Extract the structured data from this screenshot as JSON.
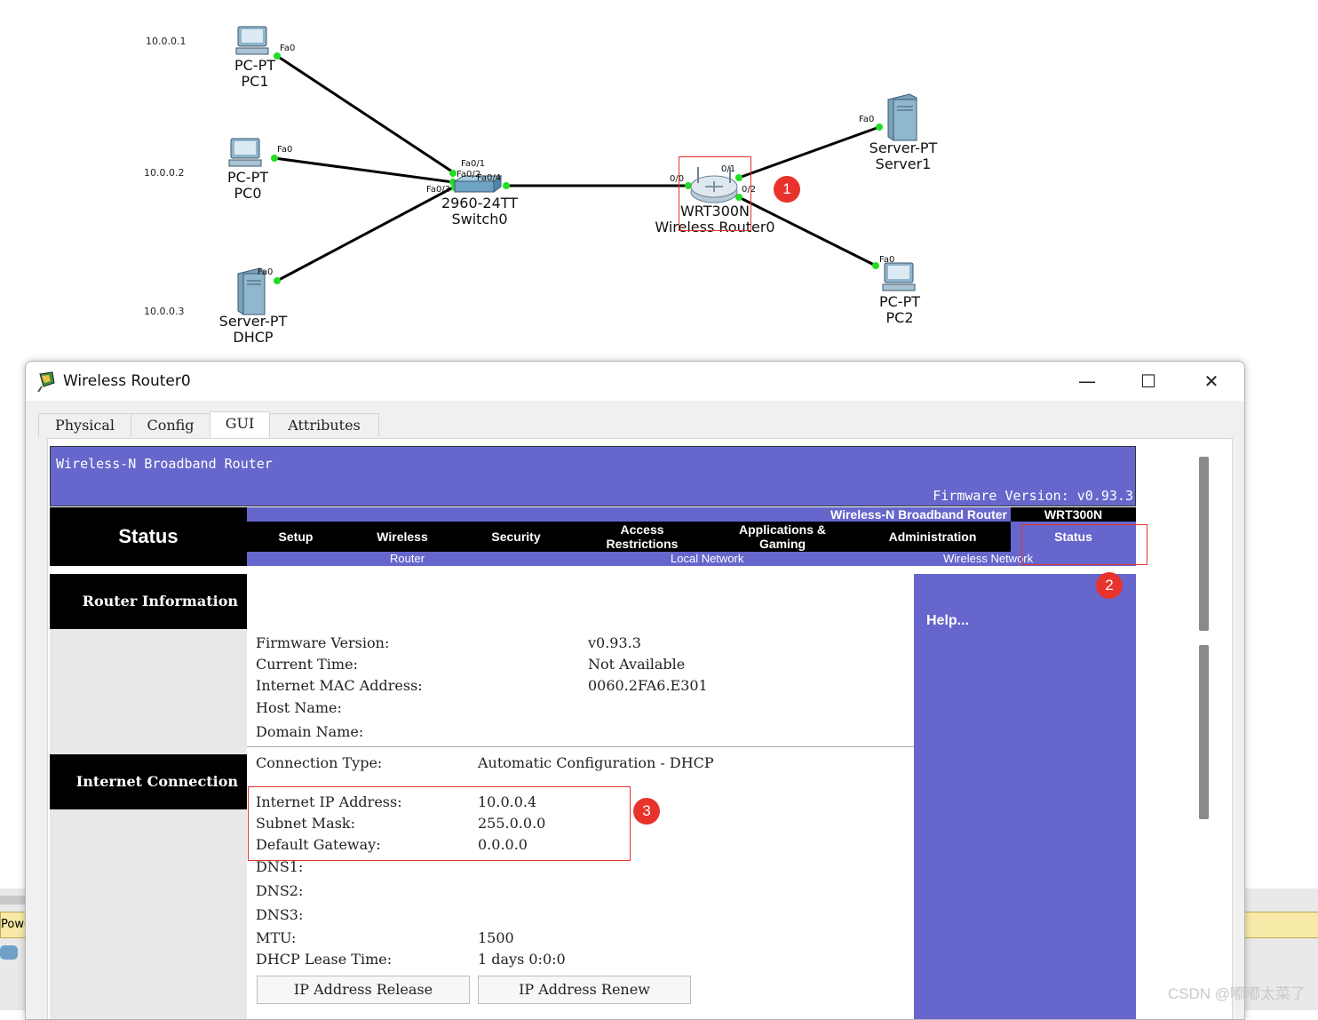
{
  "topology": {
    "ips": [
      "10.0.0.1",
      "10.0.0.2",
      "10.0.0.3"
    ],
    "devices": {
      "pc1": {
        "type": "PC-PT",
        "name": "PC1"
      },
      "pc0": {
        "type": "PC-PT",
        "name": "PC0"
      },
      "dhcp": {
        "type": "Server-PT",
        "name": "DHCP"
      },
      "switch0": {
        "type": "2960-24TT",
        "name": "Switch0"
      },
      "router": {
        "type": "WRT300N",
        "name": "Wireless Router0"
      },
      "server1": {
        "type": "Server-PT",
        "name": "Server1"
      },
      "pc2": {
        "type": "PC-PT",
        "name": "PC2"
      }
    },
    "ports": {
      "pc1_fa0": "Fa0",
      "pc0_fa0": "Fa0",
      "dhcp_fa0": "Fa0",
      "sw_fa01": "Fa0/1",
      "sw_fa02": "Fa0/2",
      "sw_fa03": "Fa0/3",
      "sw_fa04": "Fa0/4",
      "r_00": "0/0",
      "r_01": "0/1",
      "r_02": "0/2",
      "srv1_fa0": "Fa0",
      "pc2_fa0": "Fa0"
    },
    "badges": [
      "1",
      "2",
      "3"
    ]
  },
  "window": {
    "title": "Wireless Router0",
    "minimize": "—",
    "maximize": "☐",
    "close": "✕",
    "tabs": [
      "Physical",
      "Config",
      "GUI",
      "Attributes"
    ],
    "active_tab": "GUI"
  },
  "gui": {
    "header_title": "Wireless-N Broadband Router",
    "header_firmware": "Firmware Version: v0.93.3",
    "page_title": "Status",
    "product_name": "Wireless-N Broadband Router",
    "model": "WRT300N",
    "nav": [
      "Setup",
      "Wireless",
      "Security",
      "Access Restrictions",
      "Applications & Gaming",
      "Administration",
      "Status"
    ],
    "subnav": [
      "Router",
      "Local Network",
      "Wireless Network"
    ],
    "sections": {
      "router_info": "Router Information",
      "internet_conn": "Internet Connection"
    },
    "help": "Help...",
    "router_info": {
      "firmware_label": "Firmware Version:",
      "firmware_value": "v0.93.3",
      "time_label": "Current Time:",
      "time_value": "Not Available",
      "mac_label": "Internet MAC Address:",
      "mac_value": "0060.2FA6.E301",
      "host_label": "Host Name:",
      "domain_label": "Domain Name:"
    },
    "internet": {
      "conn_type_label": "Connection Type:",
      "conn_type_value": "Automatic Configuration - DHCP",
      "ip_label": "Internet IP Address:",
      "ip_value": "10.0.0.4",
      "mask_label": "Subnet Mask:",
      "mask_value": "255.0.0.0",
      "gw_label": "Default Gateway:",
      "gw_value": "0.0.0.0",
      "dns1_label": "DNS1:",
      "dns2_label": "DNS2:",
      "dns3_label": "DNS3:",
      "mtu_label": "MTU:",
      "mtu_value": "1500",
      "lease_label": "DHCP Lease Time:",
      "lease_value": "1 days 0:0:0"
    },
    "buttons": {
      "release": "IP Address Release",
      "renew": "IP Address Renew"
    }
  },
  "background": {
    "power_fragment": "Powe"
  },
  "watermark": "CSDN @嘟嘟太菜了",
  "colors": {
    "accent_purple": "#6666cc",
    "badge_red": "#e8332c",
    "link_green": "#22dd22"
  }
}
